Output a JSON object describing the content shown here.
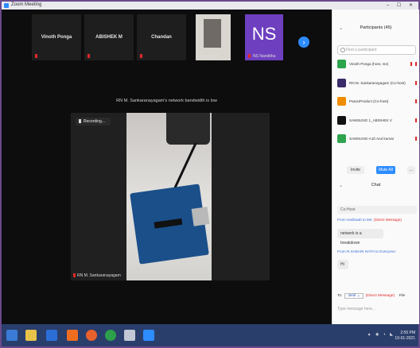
{
  "window": {
    "title": "Zoom Meeting",
    "controls": "– ☐ ✕"
  },
  "gallery": {
    "tiles": [
      {
        "name": "Vinoth Ponga"
      },
      {
        "name": "ABISHEK M"
      },
      {
        "name": "Chandan"
      }
    ],
    "camera_tile_label": "Sumesh M S",
    "ns_tile": {
      "initials": "NS",
      "label": "NS Nanditha"
    },
    "next_button": "›"
  },
  "share": {
    "bandwidth_notice": "RN M. Sankaranayagam's network bandwidth is low",
    "recording_label": "Recording...",
    "sharer_label": "RN M. Sankaranayagam"
  },
  "panel": {
    "participants_title": "Participants (45)",
    "collapse_glyph": "⌄",
    "search_placeholder": "Find a participant",
    "participants": [
      {
        "name": "Vinoth Ponga (host, me)",
        "color": "#2ea44f"
      },
      {
        "name": "RN M. Sankaranayagam (Co-host)",
        "color": "#3b2b6a"
      },
      {
        "name": "ParaUProduct (Co-host)",
        "color": "#f08c00"
      },
      {
        "name": "SAMSUNG 1_ABISHEK V",
        "color": "#111111"
      },
      {
        "name": "SAMSUNG-A10 Arul kumar",
        "color": "#2ea44f"
      }
    ],
    "buttons": {
      "invite": "Invite",
      "mute_all": "Mute All",
      "more": "..."
    },
    "chat_title": "Chat",
    "chat_to_host": "Co-Host",
    "messages": [
      {
        "from": "From Haribaab to Me:",
        "flag": "(Direct Message)",
        "text": "network is a breakdown"
      },
      {
        "from": "From R.SABARI RATH to Everyone:",
        "flag": "",
        "text": "Hi"
      }
    ],
    "to_label": "To:",
    "to_value": "Jenil ⌄",
    "dm_flag": "(Direct Message)",
    "file_label": "File",
    "input_placeholder": "Type message here..."
  },
  "taskbar": {
    "icons": [
      "windows-start",
      "explorer",
      "ie",
      "media",
      "firefox",
      "chrome",
      "app",
      "zoom"
    ],
    "tray": "▲ ◉ ◖ ◣",
    "time": "2:55 PM",
    "date": "10-01-2021"
  }
}
